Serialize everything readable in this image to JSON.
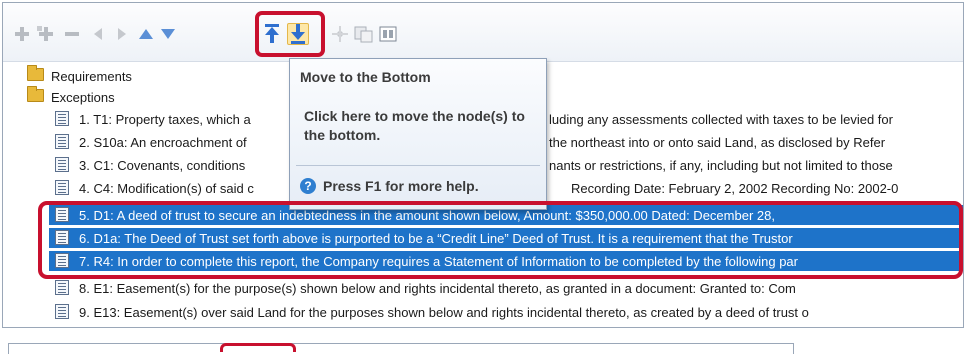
{
  "tooltip": {
    "title": "Move to the Bottom",
    "body": "Click here to move the node(s) to the bottom.",
    "help": "Press F1 for more help."
  },
  "toolbar": {
    "buttons": [
      "add-icon",
      "add-child-icon",
      "remove-icon",
      "move-left-icon",
      "move-right-icon",
      "move-up-icon",
      "move-down-icon",
      "move-to-top-icon",
      "move-to-bottom-icon",
      "expand-icon",
      "copy-icon",
      "view-icon"
    ]
  },
  "tree": {
    "requirements": "Requirements",
    "exceptions": "Exceptions",
    "items": [
      "1. T1: Property taxes, which a",
      "2. S10a: An encroachment of",
      "3. C1: Covenants, conditions",
      "4. C4: Modification(s) of said c",
      "5. D1: A deed of trust to secure an indebtedness in the amount shown below,    Amount:  $350,000.00  Dated:  December 28,",
      "6. D1a: The Deed of Trust set forth above is purported to be a “Credit Line” Deed of Trust.  It is a requirement that the Trustor",
      "7. R4: In order to complete this report, the Company requires a Statement of Information to be completed by the following par",
      "8. E1: Easement(s) for the purpose(s) shown below and rights incidental thereto, as granted in a document:    Granted to:  Com",
      "9. E13: Easement(s) over said Land for the purposes shown below and rights incidental thereto, as created by a deed of trust o"
    ],
    "overflow_text": {
      "t1": "luding any assessments collected with taxes to be levied for",
      "s10a": "the northeast into or onto said Land, as disclosed by Refer",
      "c1": "nants or restrictions, if any, including but not limited to those",
      "c4": "Recording Date:  February 2, 2002  Recording No:  2002-0"
    }
  },
  "colors": {
    "selection": "#1e73c9",
    "highlight": "#c8102e",
    "tooltip_border": "#8ea0b8"
  }
}
